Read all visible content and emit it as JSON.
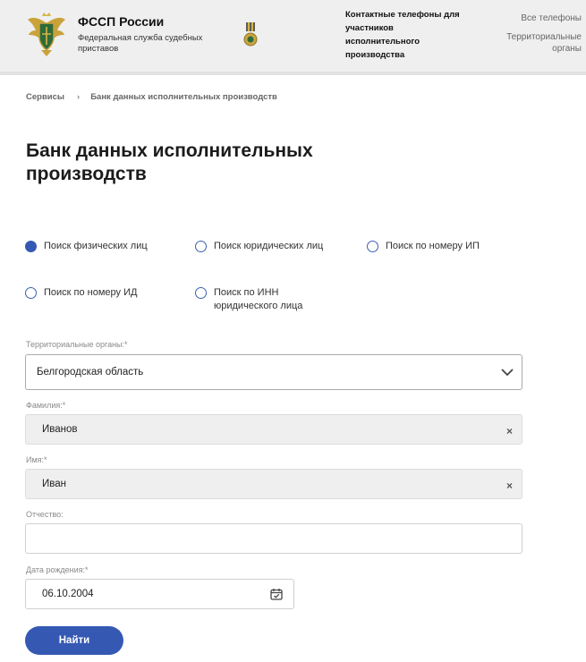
{
  "header": {
    "org_title": "ФССП России",
    "org_subtitle": "Федеральная служба судебных приставов",
    "contacts_title": "Контактные телефоны для участников исполнительного производства",
    "links": {
      "all_phones": "Все телефоны",
      "territorial": "Территориальные органы"
    },
    "colors": {
      "bar_background": "#efefef",
      "emblem_gold": "#c9a23a",
      "emblem_green": "#2e6b3a"
    }
  },
  "breadcrumb": {
    "items": [
      "Сервисы",
      "Банк данных исполнительных производств"
    ],
    "separator": "›"
  },
  "page": {
    "title": "Банк данных исполнительных производств"
  },
  "search_modes": [
    {
      "label": "Поиск физических лиц",
      "selected": true
    },
    {
      "label": "Поиск юридических лиц",
      "selected": false
    },
    {
      "label": "Поиск по номеру ИП",
      "selected": false
    },
    {
      "label": "Поиск по номеру ИД",
      "selected": false
    },
    {
      "label": "Поиск по ИНН юридического лица",
      "selected": false
    }
  ],
  "form": {
    "region": {
      "label": "Территориальные органы:*",
      "value": "Белгородская область"
    },
    "last_name": {
      "label": "Фамилия:*",
      "value": "Иванов"
    },
    "first_name": {
      "label": "Имя:*",
      "value": "Иван"
    },
    "patronymic": {
      "label": "Отчество:",
      "value": ""
    },
    "birth_date": {
      "label": "Дата рождения:*",
      "value": "06.10.2004"
    },
    "clear_glyph": "×",
    "submit_label": "Найти",
    "accent_color": "#3559b3"
  },
  "icons": {
    "emblem": "fssp-emblem-icon",
    "medal": "medal-icon",
    "select_arrow": "chevron-down-icon",
    "calendar": "calendar-icon"
  }
}
